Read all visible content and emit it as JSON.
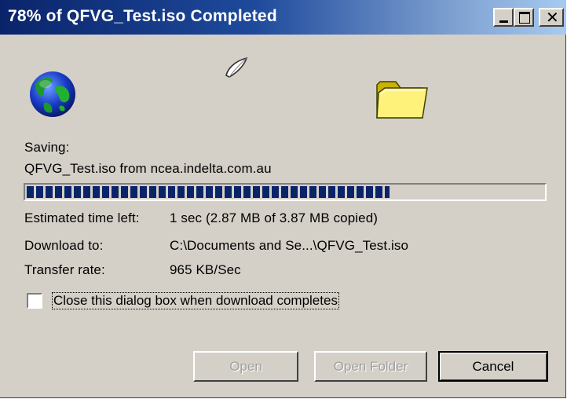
{
  "window": {
    "title": "78% of QFVG_Test.iso Completed",
    "close_glyph": "✕"
  },
  "icons": {
    "source": "globe-icon",
    "transfer": "paper-sheet-icon",
    "destination": "folder-icon"
  },
  "status": {
    "saving_label": "Saving:",
    "file_line": "QFVG_Test.iso from ncea.indelta.com.au",
    "progress_fraction": 0.78
  },
  "details": {
    "time_label": "Estimated time left:",
    "time_value": "1 sec (2.87 MB of 3.87 MB copied)",
    "download_label": "Download to:",
    "download_value": "C:\\Documents and Se...\\QFVG_Test.iso",
    "rate_label": "Transfer rate:",
    "rate_value": "965 KB/Sec"
  },
  "options": {
    "close_when_done_label": "Close this dialog box when download completes",
    "close_when_done_checked": false
  },
  "buttons": {
    "open_label": "Open",
    "open_folder_label": "Open Folder",
    "cancel_label": "Cancel"
  },
  "colors": {
    "title_bar_start": "#0a246a",
    "title_bar_end": "#a6caf0",
    "progress_block": "#0a246a",
    "dialog_face": "#d4d0c8"
  }
}
